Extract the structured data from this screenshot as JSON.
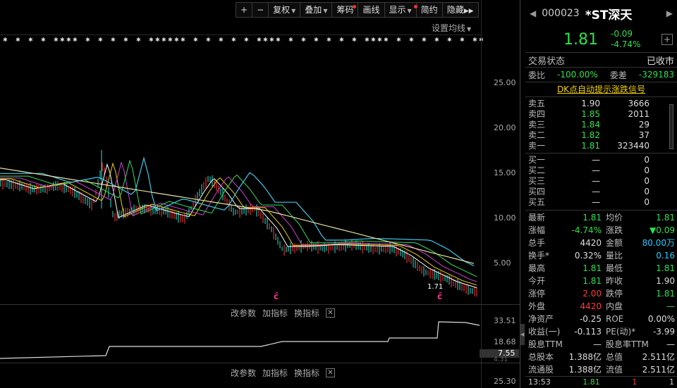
{
  "toolbar": {
    "plus": "+",
    "minus": "−",
    "fuquan": "复权",
    "diejia": "叠加",
    "chouma": "筹码",
    "huaxian": "画线",
    "xianshi": "显示",
    "jianyue": "简约",
    "yincang": "隐藏"
  },
  "chart_labels": {
    "setting": "设置均线",
    "y_ticks": [
      "25.00",
      "20.00",
      "15.00",
      "10.00",
      "5.00"
    ],
    "sub1_y": [
      "33.51",
      "18.68",
      "7.55",
      "4.31"
    ],
    "sub2_y": [
      "25.30"
    ],
    "low_tag": "1.71",
    "marker": "ĉ"
  },
  "subbar": {
    "gaicanshu": "改参数",
    "jiazhibiao": "加指标",
    "huanzhibiao": "换指标",
    "close": "✕"
  },
  "quote": {
    "code": "000023",
    "name": "*ST深天",
    "price": "1.81",
    "change": "-0.09",
    "pct": "-4.74%",
    "add": "+"
  },
  "status": {
    "label": "交易状态",
    "value": "已收市"
  },
  "weibi": {
    "label": "委比",
    "value": "-100.00%",
    "diff_label": "委差",
    "diff": "-329183"
  },
  "dk_link": "DK点自动提示涨跌信号",
  "sell": [
    {
      "name": "卖五",
      "price": "1.90",
      "vol": "3666"
    },
    {
      "name": "卖四",
      "price": "1.85",
      "vol": "2011"
    },
    {
      "name": "卖三",
      "price": "1.84",
      "vol": "29"
    },
    {
      "name": "卖二",
      "price": "1.82",
      "vol": "37"
    },
    {
      "name": "卖一",
      "price": "1.81",
      "vol": "323440"
    }
  ],
  "buy": [
    {
      "name": "买一",
      "price": "—",
      "vol": "0"
    },
    {
      "name": "买二",
      "price": "—",
      "vol": "0"
    },
    {
      "name": "买三",
      "price": "—",
      "vol": "0"
    },
    {
      "name": "买四",
      "price": "—",
      "vol": "0"
    },
    {
      "name": "买五",
      "price": "—",
      "vol": "0"
    }
  ],
  "stats": [
    [
      "最新",
      "1.81",
      "均价",
      "1.81"
    ],
    [
      "涨幅",
      "-4.74%",
      "涨跌",
      "▼0.09"
    ],
    [
      "总手",
      "4420",
      "金额",
      "80.00万"
    ],
    [
      "换手*",
      "0.32%",
      "量比",
      "0.16"
    ],
    [
      "最高",
      "1.81",
      "最低",
      "1.81"
    ],
    [
      "今开",
      "1.81",
      "昨收",
      "1.90"
    ],
    [
      "涨停",
      "2.00",
      "跌停",
      "1.81"
    ],
    [
      "外盘",
      "4420",
      "内盘",
      "—"
    ],
    [
      "净资产",
      "-0.25",
      "ROE",
      "0.00%"
    ],
    [
      "收益(一)",
      "-0.113",
      "PE(动)*",
      "-3.99"
    ],
    [
      "股息TTM",
      "—",
      "股息率TTM",
      "—"
    ],
    [
      "总股本",
      "1.388亿",
      "总值",
      "2.511亿"
    ],
    [
      "流通股",
      "1.388亿",
      "流值",
      "2.511亿"
    ]
  ],
  "tick": {
    "time": "13:53",
    "price": "1.81",
    "vol": "1",
    "dir": "1"
  },
  "colors": {
    "up": "#ff3a3a",
    "down": "#2ee04c",
    "bg": "#000000",
    "ma_yellow": "#e8e0a0",
    "ma_cyan": "#3cc8e8"
  }
}
